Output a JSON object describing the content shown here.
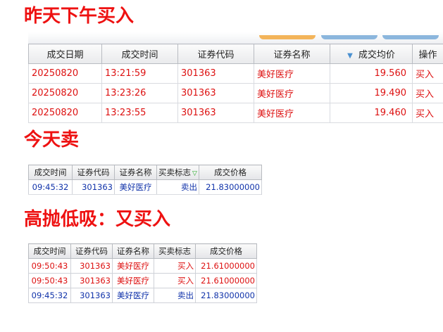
{
  "headings": {
    "yesterday": "昨天下午买入",
    "today": "今天卖",
    "swing": "高抛低吸：又买入"
  },
  "table_yesterday": {
    "columns": [
      "成交日期",
      "成交时间",
      "证券代码",
      "证券名称",
      "成交均价",
      "操作"
    ],
    "rows": [
      {
        "date": "20250820",
        "time": "13:21:59",
        "code": "301363",
        "name": "美好医疗",
        "price": "19.560",
        "op": "买入"
      },
      {
        "date": "20250820",
        "time": "13:23:26",
        "code": "301363",
        "name": "美好医疗",
        "price": "19.490",
        "op": "买入"
      },
      {
        "date": "20250820",
        "time": "13:23:55",
        "code": "301363",
        "name": "美好医疗",
        "price": "19.460",
        "op": "买入"
      }
    ]
  },
  "table_today": {
    "columns": [
      "成交时间",
      "证券代码",
      "证券名称",
      "买卖标志",
      "成交价格"
    ],
    "rows": [
      {
        "time": "09:45:32",
        "code": "301363",
        "name": "美好医疗",
        "side": "卖出",
        "price": "21.83000000"
      }
    ]
  },
  "table_swing": {
    "columns": [
      "成交时间",
      "证券代码",
      "证券名称",
      "买卖标志",
      "成交价格"
    ],
    "rows": [
      {
        "time": "09:50:43",
        "code": "301363",
        "name": "美好医疗",
        "side": "买入",
        "price": "21.61000000"
      },
      {
        "time": "09:50:43",
        "code": "301363",
        "name": "美好医疗",
        "side": "买入",
        "price": "21.61000000"
      },
      {
        "time": "09:45:32",
        "code": "301363",
        "name": "美好医疗",
        "side": "卖出",
        "price": "21.83000000"
      }
    ]
  },
  "icons": {
    "sort_desc": "sort-desc-icon",
    "sort_green": "sort-indicator-icon"
  },
  "colors": {
    "heading": "#ee1111",
    "buy": "#dd1111",
    "sell": "#1133aa"
  }
}
